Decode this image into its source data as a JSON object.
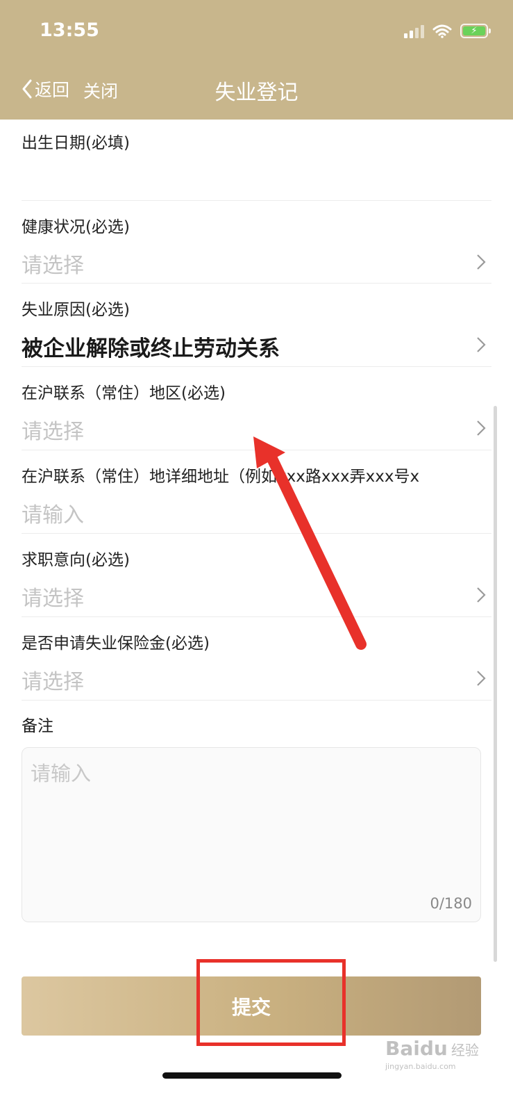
{
  "status_bar": {
    "time": "13:55"
  },
  "nav": {
    "back_label": "返回",
    "close_label": "关闭",
    "title": "失业登记"
  },
  "form": {
    "rows": [
      {
        "label": "出生日期(必填)",
        "value": "",
        "has_chevron": false
      },
      {
        "label": "健康状况(必选)",
        "value": "请选择",
        "has_chevron": true
      },
      {
        "label": "失业原因(必选)",
        "value": "被企业解除或终止劳动关系",
        "has_chevron": true,
        "filled": true
      },
      {
        "label": "在沪联系（常住）地区(必选)",
        "value": "请选择",
        "has_chevron": true
      },
      {
        "label": "在沪联系（常住）地详细地址（例如xxx路xxx弄xxx号x",
        "value": "请输入",
        "has_chevron": false
      },
      {
        "label": "求职意向(必选)",
        "value": "请选择",
        "has_chevron": true
      },
      {
        "label": "是否申请失业保险金(必选)",
        "value": "请选择",
        "has_chevron": true
      }
    ],
    "remark": {
      "label": "备注",
      "placeholder": "请输入",
      "counter": "0/180"
    },
    "submit_label": "提交"
  },
  "watermark": {
    "brand": "Baidu",
    "cn": "经验",
    "url": "jingyan.baidu.com"
  },
  "colors": {
    "header": "#c8b68c",
    "highlight": "#e8312a",
    "placeholder": "#c4c4c4"
  },
  "icons": [
    "chevron-left-icon",
    "signal-icon",
    "wifi-icon",
    "battery-icon",
    "chevron-right-icon"
  ]
}
